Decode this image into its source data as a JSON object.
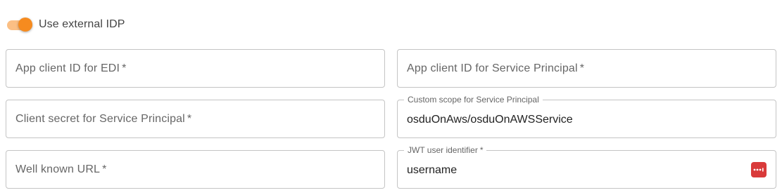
{
  "toggle": {
    "label": "Use external IDP",
    "checked": true,
    "accent_color": "#f68b1f"
  },
  "fields": {
    "app_client_edi": {
      "label": "App client ID for EDI",
      "required_mark": "*",
      "value": ""
    },
    "app_client_sp": {
      "label": "App client ID for Service Principal",
      "required_mark": "*",
      "value": ""
    },
    "client_secret_sp": {
      "label": "Client secret for Service Principal",
      "required_mark": "*",
      "value": ""
    },
    "custom_scope_sp": {
      "label": "Custom scope for Service Principal",
      "value": "osduOnAws/osduOnAWSService"
    },
    "well_known_url": {
      "label": "Well known URL",
      "required_mark": "*",
      "value": ""
    },
    "jwt_user_identifier": {
      "label": "JWT user identifier",
      "required_mark": "*",
      "value": "username",
      "icon": "password-manager-icon"
    }
  }
}
